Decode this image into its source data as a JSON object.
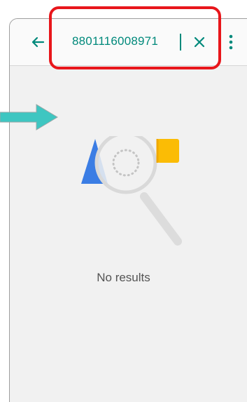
{
  "search": {
    "query": "8801116008971"
  },
  "empty_state": {
    "message": "No results"
  },
  "icons": {
    "back": "arrow-left-icon",
    "clear": "close-icon",
    "menu": "more-vert-icon"
  },
  "colors": {
    "accent": "#00897b",
    "highlight": "#e8161b",
    "pointer": "#3ec6c1"
  }
}
